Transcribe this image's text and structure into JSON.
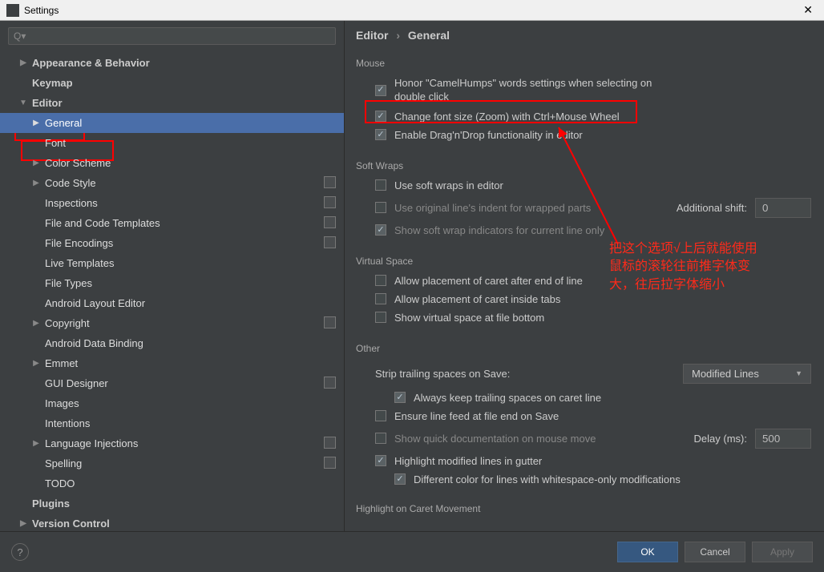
{
  "window": {
    "title": "Settings"
  },
  "search": {
    "placeholder": ""
  },
  "sidebar": {
    "items": [
      {
        "label": "Appearance & Behavior",
        "level": 1,
        "arrow": "right",
        "bold": true
      },
      {
        "label": "Keymap",
        "level": 1,
        "arrow": "none",
        "bold": true
      },
      {
        "label": "Editor",
        "level": 1,
        "arrow": "down",
        "bold": true
      },
      {
        "label": "General",
        "level": 2,
        "arrow": "right",
        "selected": true
      },
      {
        "label": "Font",
        "level": 2,
        "arrow": "none"
      },
      {
        "label": "Color Scheme",
        "level": 2,
        "arrow": "right"
      },
      {
        "label": "Code Style",
        "level": 2,
        "arrow": "right",
        "copy": true
      },
      {
        "label": "Inspections",
        "level": 2,
        "arrow": "none",
        "copy": true
      },
      {
        "label": "File and Code Templates",
        "level": 2,
        "arrow": "none",
        "copy": true
      },
      {
        "label": "File Encodings",
        "level": 2,
        "arrow": "none",
        "copy": true
      },
      {
        "label": "Live Templates",
        "level": 2,
        "arrow": "none"
      },
      {
        "label": "File Types",
        "level": 2,
        "arrow": "none"
      },
      {
        "label": "Android Layout Editor",
        "level": 2,
        "arrow": "none"
      },
      {
        "label": "Copyright",
        "level": 2,
        "arrow": "right",
        "copy": true
      },
      {
        "label": "Android Data Binding",
        "level": 2,
        "arrow": "none"
      },
      {
        "label": "Emmet",
        "level": 2,
        "arrow": "right"
      },
      {
        "label": "GUI Designer",
        "level": 2,
        "arrow": "none",
        "copy": true
      },
      {
        "label": "Images",
        "level": 2,
        "arrow": "none"
      },
      {
        "label": "Intentions",
        "level": 2,
        "arrow": "none"
      },
      {
        "label": "Language Injections",
        "level": 2,
        "arrow": "right",
        "copy": true
      },
      {
        "label": "Spelling",
        "level": 2,
        "arrow": "none",
        "copy": true
      },
      {
        "label": "TODO",
        "level": 2,
        "arrow": "none"
      },
      {
        "label": "Plugins",
        "level": 1,
        "arrow": "none",
        "bold": true
      },
      {
        "label": "Version Control",
        "level": 1,
        "arrow": "right",
        "bold": true
      }
    ]
  },
  "breadcrumb": {
    "a": "Editor",
    "b": "General"
  },
  "mouse": {
    "title": "Mouse",
    "honor": "Honor \"CamelHumps\" words settings when selecting on double click",
    "zoom": "Change font size (Zoom) with Ctrl+Mouse Wheel",
    "dnd": "Enable Drag'n'Drop functionality in editor"
  },
  "softwraps": {
    "title": "Soft Wraps",
    "use": "Use soft wraps in editor",
    "orig": "Use original line's indent for wrapped parts",
    "shift_label": "Additional shift:",
    "shift_value": "0",
    "show": "Show soft wrap indicators for current line only"
  },
  "vspace": {
    "title": "Virtual Space",
    "caret_end": "Allow placement of caret after end of line",
    "caret_tabs": "Allow placement of caret inside tabs",
    "show_bottom": "Show virtual space at file bottom"
  },
  "other": {
    "title": "Other",
    "strip_label": "Strip trailing spaces on Save:",
    "strip_value": "Modified Lines",
    "always_keep": "Always keep trailing spaces on caret line",
    "ensure_lf": "Ensure line feed at file end on Save",
    "quick_doc": "Show quick documentation on mouse move",
    "delay_label": "Delay (ms):",
    "delay_value": "500",
    "hl_mod": "Highlight modified lines in gutter",
    "diff_color": "Different color for lines with whitespace-only modifications",
    "hl_caret": "Highlight on Caret Movement"
  },
  "buttons": {
    "ok": "OK",
    "cancel": "Cancel",
    "apply": "Apply"
  },
  "annotation": {
    "line1": "把这个选项√上后就能使用",
    "line2": "鼠标的滚轮往前推字体变",
    "line3": "大，往后拉字体缩小"
  }
}
